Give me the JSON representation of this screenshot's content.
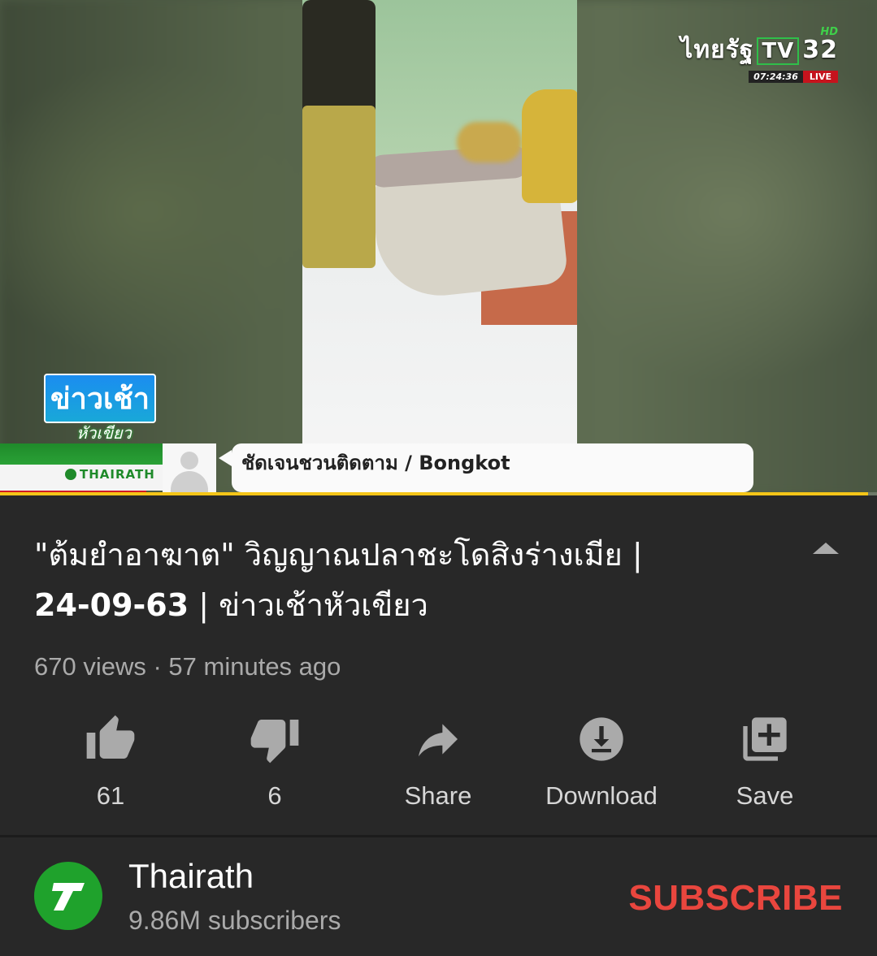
{
  "player": {
    "channel_logo": {
      "brand": "ไทยรัฐ",
      "tv": "TV",
      "number": "32",
      "hd": "HD",
      "clock": "07:24:36",
      "live": "LIVE"
    },
    "show_logo": {
      "line1": "ข่าวเช้า",
      "line2": "หัวเขียว"
    },
    "lower_third": {
      "brand": "THAIRATH",
      "caption": "ชัดเจนชวนติดตาม / Bongkot"
    },
    "progress": 0.99
  },
  "video": {
    "title_main": "\"ต้มยำอาฆาต\" วิญญาณปลาชะโดสิงร่างเมีย |",
    "title_date": "24-09-63",
    "title_rest": " | ข่าวเช้าหัวเขียว",
    "views": "670 views",
    "separator": " · ",
    "age": "57 minutes ago"
  },
  "actions": {
    "like": {
      "label": "61",
      "icon": "thumbs-up-icon"
    },
    "dislike": {
      "label": "6",
      "icon": "thumbs-down-icon"
    },
    "share": {
      "label": "Share",
      "icon": "share-icon"
    },
    "download": {
      "label": "Download",
      "icon": "download-icon"
    },
    "save": {
      "label": "Save",
      "icon": "add-to-playlist-icon"
    }
  },
  "channel": {
    "name": "Thairath",
    "subscribers": "9.86M subscribers",
    "subscribe_label": "SUBSCRIBE",
    "avatar_letter": "T"
  },
  "colors": {
    "background": "#282828",
    "subscribe": "#e9463e",
    "channel_green": "#1fa22c",
    "progress": "#f5c518"
  }
}
